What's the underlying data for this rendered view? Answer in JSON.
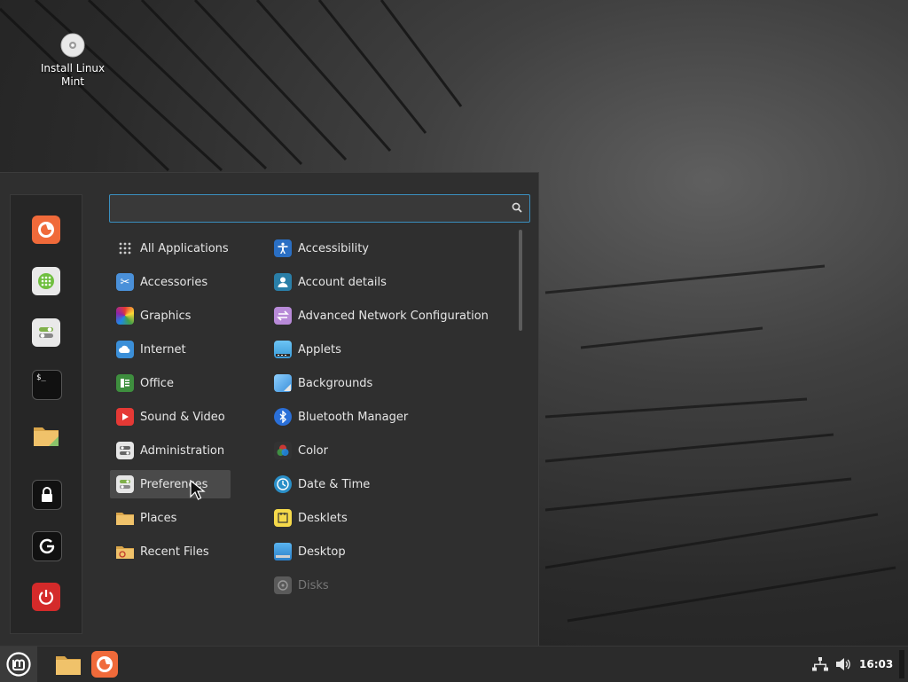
{
  "desktop": {
    "icon_label": "Install Linux Mint"
  },
  "menu": {
    "search": {
      "value": "",
      "placeholder": ""
    },
    "favorites": [
      {
        "name": "firefox-icon"
      },
      {
        "name": "software-manager-icon"
      },
      {
        "name": "system-settings-icon"
      },
      {
        "name": "terminal-icon"
      },
      {
        "name": "files-icon"
      },
      {
        "name": "lock-screen-icon"
      },
      {
        "name": "logout-icon"
      },
      {
        "name": "power-icon"
      }
    ],
    "categories": [
      {
        "label": "All Applications",
        "icon": "grid-icon"
      },
      {
        "label": "Accessories",
        "icon": "accessories-icon"
      },
      {
        "label": "Graphics",
        "icon": "graphics-icon"
      },
      {
        "label": "Internet",
        "icon": "internet-icon"
      },
      {
        "label": "Office",
        "icon": "office-icon"
      },
      {
        "label": "Sound & Video",
        "icon": "sound-video-icon"
      },
      {
        "label": "Administration",
        "icon": "administration-icon"
      },
      {
        "label": "Preferences",
        "icon": "preferences-icon"
      },
      {
        "label": "Places",
        "icon": "places-icon"
      },
      {
        "label": "Recent Files",
        "icon": "recent-files-icon"
      }
    ],
    "active_category": "Preferences",
    "apps": [
      {
        "label": "Accessibility",
        "icon": "accessibility-icon"
      },
      {
        "label": "Account details",
        "icon": "account-details-icon"
      },
      {
        "label": "Advanced Network Configuration",
        "icon": "network-config-icon"
      },
      {
        "label": "Applets",
        "icon": "applets-icon"
      },
      {
        "label": "Backgrounds",
        "icon": "backgrounds-icon"
      },
      {
        "label": "Bluetooth Manager",
        "icon": "bluetooth-icon"
      },
      {
        "label": "Color",
        "icon": "color-icon"
      },
      {
        "label": "Date & Time",
        "icon": "clock-icon"
      },
      {
        "label": "Desklets",
        "icon": "desklets-icon"
      },
      {
        "label": "Desktop",
        "icon": "desktop-icon"
      },
      {
        "label": "Disks",
        "icon": "disks-icon"
      }
    ]
  },
  "panel": {
    "clock": "16:03",
    "tray_icons": [
      "network-icon",
      "volume-icon"
    ]
  },
  "colors": {
    "accent": "#3a8fbf",
    "panel_bg": "#2b2b2b",
    "menu_bg": "#2f2f2f"
  }
}
